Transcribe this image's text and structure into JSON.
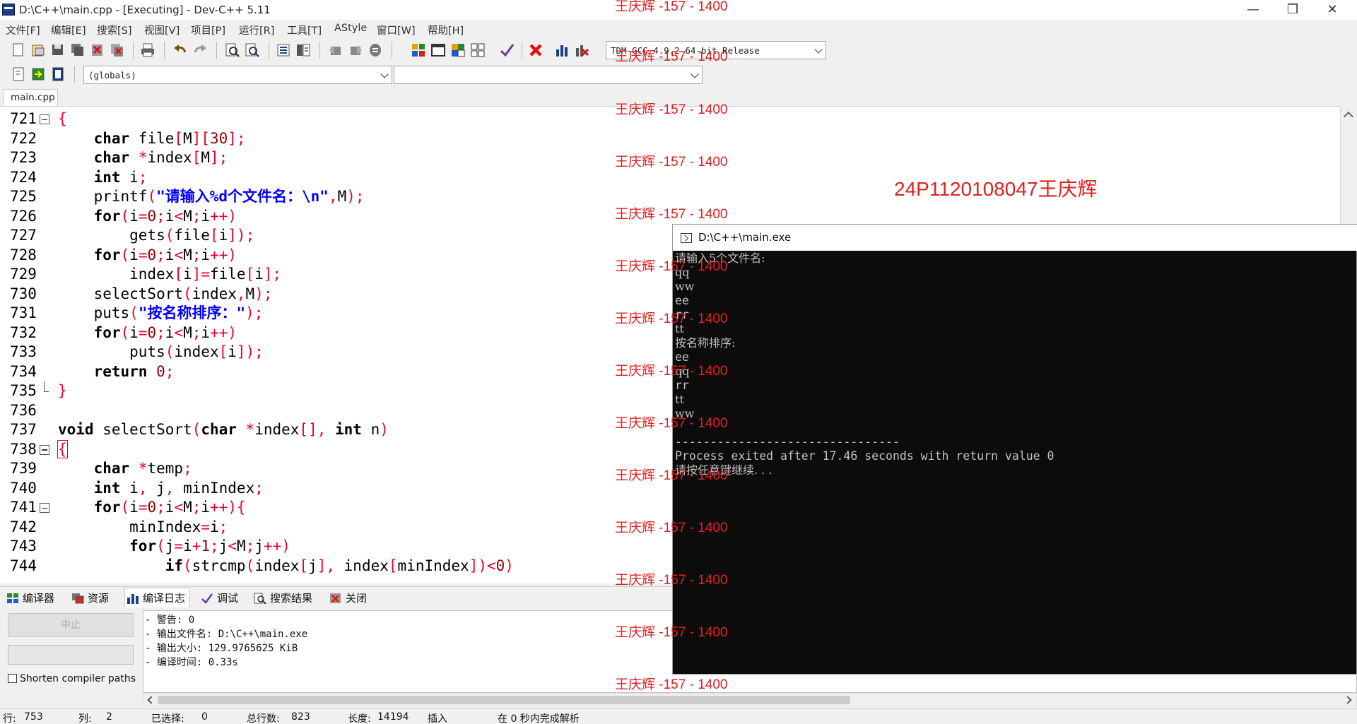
{
  "window": {
    "title": "D:\\C++\\main.cpp - [Executing] - Dev-C++ 5.11"
  },
  "menu": [
    "文件[F]",
    "编辑[E]",
    "搜索[S]",
    "视图[V]",
    "项目[P]",
    "运行[R]",
    "工具[T]",
    "AStyle",
    "窗口[W]",
    "帮助[H]"
  ],
  "toolbar": {
    "compiler_select": "TDM-GCC 4.9.2 64-bit Release",
    "scope_select": "(globals)",
    "symbol_select": ""
  },
  "tabs": [
    {
      "label": "main.cpp"
    }
  ],
  "editor": {
    "lines": [
      {
        "n": "721",
        "fold": "open",
        "html": "<span class='pn'>{</span>"
      },
      {
        "n": "722",
        "html": "    <span class='kw'>char</span> file<span class='pn'>[</span>M<span class='pn'>][</span><span class='nm'>30</span><span class='pn'>];</span>"
      },
      {
        "n": "723",
        "html": "    <span class='kw'>char</span> <span class='pn'>*</span>index<span class='pn'>[</span>M<span class='pn'>];</span>"
      },
      {
        "n": "724",
        "html": "    <span class='kw'>int</span> i<span class='pn'>;</span>"
      },
      {
        "n": "725",
        "html": "    printf<span class='pn'>(</span><span class='st'>\"请输入%d个文件名：\\n\"</span><span class='pn'>,</span>M<span class='pn'>);</span>"
      },
      {
        "n": "726",
        "html": "    <span class='kw'>for</span><span class='pn'>(</span>i<span class='pn'>=</span><span class='nm'>0</span><span class='pn'>;</span>i<span class='pn'>&lt;</span>M<span class='pn'>;</span>i<span class='pn'>++)</span>"
      },
      {
        "n": "727",
        "html": "        gets<span class='pn'>(</span>file<span class='pn'>[</span>i<span class='pn'>]);</span>"
      },
      {
        "n": "728",
        "html": "    <span class='kw'>for</span><span class='pn'>(</span>i<span class='pn'>=</span><span class='nm'>0</span><span class='pn'>;</span>i<span class='pn'>&lt;</span>M<span class='pn'>;</span>i<span class='pn'>++)</span>"
      },
      {
        "n": "729",
        "html": "        index<span class='pn'>[</span>i<span class='pn'>]=</span>file<span class='pn'>[</span>i<span class='pn'>];</span>"
      },
      {
        "n": "730",
        "html": "    selectSort<span class='pn'>(</span>index<span class='pn'>,</span>M<span class='pn'>);</span>"
      },
      {
        "n": "731",
        "html": "    puts<span class='pn'>(</span><span class='st'>\"按名称排序：\"</span><span class='pn'>);</span>"
      },
      {
        "n": "732",
        "html": "    <span class='kw'>for</span><span class='pn'>(</span>i<span class='pn'>=</span><span class='nm'>0</span><span class='pn'>;</span>i<span class='pn'>&lt;</span>M<span class='pn'>;</span>i<span class='pn'>++)</span>"
      },
      {
        "n": "733",
        "html": "        puts<span class='pn'>(</span>index<span class='pn'>[</span>i<span class='pn'>]);</span>"
      },
      {
        "n": "734",
        "html": "    <span class='kw'>return</span> <span class='nm'>0</span><span class='pn'>;</span>"
      },
      {
        "n": "735",
        "fold": "end",
        "html": "<span class='pn'>}</span>"
      },
      {
        "n": "736",
        "html": ""
      },
      {
        "n": "737",
        "html": "<span class='kw'>void</span> selectSort<span class='pn'>(</span><span class='kw'>char</span> <span class='pn'>*</span>index<span class='pn'>[],</span> <span class='kw'>int</span> n<span class='pn'>)</span>"
      },
      {
        "n": "738",
        "fold": "open",
        "html": "<span class='pn' style='outline:1.5px solid #e8002b'>{</span>"
      },
      {
        "n": "739",
        "html": "    <span class='kw'>char</span> <span class='pn'>*</span>temp<span class='pn'>;</span>"
      },
      {
        "n": "740",
        "html": "    <span class='kw'>int</span> i<span class='pn'>,</span> j<span class='pn'>,</span> minIndex<span class='pn'>;</span>"
      },
      {
        "n": "741",
        "fold": "open",
        "html": "    <span class='kw'>for</span><span class='pn'>(</span>i<span class='pn'>=</span><span class='nm'>0</span><span class='pn'>;</span>i<span class='pn'>&lt;</span>M<span class='pn'>;</span>i<span class='pn'>++){</span>"
      },
      {
        "n": "742",
        "html": "        minIndex<span class='pn'>=</span>i<span class='pn'>;</span>"
      },
      {
        "n": "743",
        "html": "        <span class='kw'>for</span><span class='pn'>(</span>j<span class='pn'>=</span>i<span class='pn'>+</span><span class='nm'>1</span><span class='pn'>;</span>j<span class='pn'>&lt;</span>M<span class='pn'>;</span>j<span class='pn'>++)</span>"
      },
      {
        "n": "744",
        "html": "            <span class='kw'>if</span><span class='pn'>(</span>strcmp<span class='pn'>(</span>index<span class='pn'>[</span>j<span class='pn'>],</span> index<span class='pn'>[</span>minIndex<span class='pn'>])&lt;</span><span class='nm'>0</span><span class='pn'>)</span>"
      }
    ]
  },
  "bottom_tabs": [
    "编译器",
    "资源",
    "编译日志",
    "调试",
    "搜索结果",
    "关闭"
  ],
  "bottom_panel": {
    "abort_label": "中止",
    "shorten_label": "Shorten compiler paths",
    "log_lines": [
      "- 警告: 0",
      "- 输出文件名: D:\\C++\\main.exe",
      "- 输出大小: 129.9765625 KiB",
      "- 编译时间: 0.33s"
    ]
  },
  "status": {
    "line_label": "行:",
    "line_value": "753",
    "col_label": "列:",
    "col_value": "2",
    "sel_label": "已选择:",
    "sel_value": "0",
    "total_label": "总行数:",
    "total_value": "823",
    "len_label": "长度:",
    "len_value": "14194",
    "mode": "插入",
    "parse": "在 0 秒内完成解析"
  },
  "console": {
    "title": "D:\\C++\\main.exe",
    "lines": [
      "请输入5个文件名:",
      "qq",
      "ww",
      "ee",
      "rr",
      "tt",
      "按名称排序:",
      "ee",
      "qq",
      "rr",
      "tt",
      "ww",
      "",
      "--------------------------------",
      "Process exited after 17.46 seconds with return value 0",
      "请按任意键继续. . ."
    ]
  },
  "watermark": {
    "text": "王庆辉 -157 - 1400",
    "student_label": "24P1120108047王庆辉"
  }
}
